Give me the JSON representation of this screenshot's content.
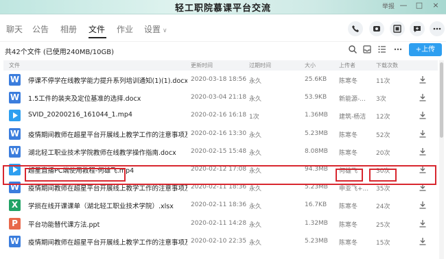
{
  "window": {
    "title": "轻工职院慕课平台交流",
    "report": "举报",
    "top_controls": [
      "—",
      "□",
      "×"
    ]
  },
  "tabs": [
    {
      "label": "聊天"
    },
    {
      "label": "公告"
    },
    {
      "label": "相册"
    },
    {
      "label": "文件"
    },
    {
      "label": "作业"
    },
    {
      "label": "设置"
    }
  ],
  "active_tab": "文件",
  "header_actions": [
    "phone-icon",
    "video-icon",
    "whiteboard-icon",
    "message-icon",
    "more-icon"
  ],
  "files": {
    "summary": "共42个文件 (已使用240MB/10GB)",
    "upload_label": "上传",
    "columns": {
      "name": "文件",
      "updated": "更新时间",
      "expire": "过期时间",
      "size": "大小",
      "uploader": "上传者",
      "downloads": "下载次数"
    },
    "rows": [
      {
        "type": "W",
        "color": "#3b7ddd",
        "name": "停课不停学在线教学能力提升系列培训通知(1)(1).docx",
        "updated": "2020-03-18 18:56",
        "expire": "永久",
        "size": "25.6KB",
        "uploader": "陈寒冬",
        "downloads": "11次"
      },
      {
        "type": "W",
        "color": "#3b7ddd",
        "name": "1.5工件的装夹及定位基准的选择.docx",
        "updated": "2020-03-04 21:18",
        "expire": "永久",
        "size": "53.9KB",
        "uploader": "新能源-...",
        "downloads": "3次"
      },
      {
        "type": "play",
        "color": "#2e9ff0",
        "name": "SVID_20200216_161044_1.mp4",
        "updated": "2020-02-16 16:18",
        "expire": "1次",
        "size": "1.36MB",
        "uploader": "建筑-杨洁",
        "downloads": "12次"
      },
      {
        "type": "W",
        "color": "#3b7ddd",
        "name": "疫情期间教师在超星平台开展线上教学工作的注意事项及推...",
        "updated": "2020-02-16 13:30",
        "expire": "永久",
        "size": "5.23MB",
        "uploader": "陈寒冬",
        "downloads": "52次"
      },
      {
        "type": "W",
        "color": "#3b7ddd",
        "name": "湖北轻工职业技术学院教师在线教学操作指南.docx",
        "updated": "2020-02-15 15:48",
        "expire": "永久",
        "size": "8.08MB",
        "uploader": "陈寒冬",
        "downloads": "20次"
      },
      {
        "type": "play",
        "color": "#2e9ff0",
        "name": "超星直播PC端使用教程-何雄飞.mp4",
        "updated": "2020-02-12 17:08",
        "expire": "永久",
        "size": "94.3MB",
        "uploader": "何雄飞",
        "downloads": "30次"
      },
      {
        "type": "W",
        "color": "#3b7ddd",
        "name": "疫情期间教师在超星平台开展线上教学工作的注意事项及推...",
        "updated": "2020-02-11 18:36",
        "expire": "永久",
        "size": "5.23MB",
        "uploader": "申亚飞+...",
        "downloads": "35次"
      },
      {
        "type": "X",
        "color": "#21a366",
        "name": "学损在线开课课单（湖北轻工职业技术学院）.xlsx",
        "updated": "2020-02-11 18:36",
        "expire": "永久",
        "size": "16.7KB",
        "uploader": "陈寒冬",
        "downloads": "24次"
      },
      {
        "type": "P",
        "color": "#e8684a",
        "name": "平台功能替代课方法.ppt",
        "updated": "2020-02-11 14:28",
        "expire": "永久",
        "size": "1.32MB",
        "uploader": "陈寒冬",
        "downloads": "25次"
      },
      {
        "type": "W",
        "color": "#3b7ddd",
        "name": "疫情期间教师在超星平台开展线上教学工作的注意事项及推...",
        "updated": "2020-02-10 22:35",
        "expire": "永久",
        "size": "5.23MB",
        "uploader": "陈寒冬",
        "downloads": "15次"
      }
    ]
  },
  "colors": {
    "accent": "#2e9ff0",
    "highlight_box": "#d8262e"
  }
}
